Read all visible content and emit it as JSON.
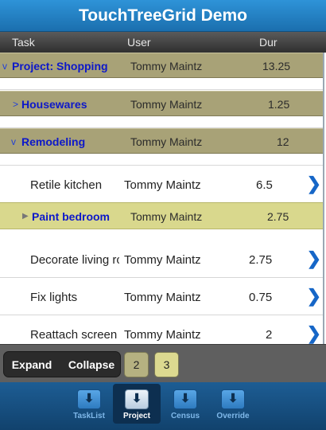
{
  "app": {
    "title": "TouchTreeGrid Demo"
  },
  "columns": {
    "task": "Task",
    "user": "User",
    "dur": "Dur"
  },
  "rows": {
    "project": {
      "twist": "v",
      "task": "Project: Shopping",
      "user": "Tommy Maintz",
      "dur": "13.25"
    },
    "housewares": {
      "twist": ">",
      "task": "Housewares",
      "user": "Tommy Maintz",
      "dur": "1.25"
    },
    "remodeling": {
      "twist": "v",
      "task": "Remodeling",
      "user": "Tommy Maintz",
      "dur": "12"
    },
    "retile": {
      "task": "Retile kitchen",
      "user": "Tommy Maintz",
      "dur": "6.5"
    },
    "paint": {
      "twist": "▶",
      "task": "Paint bedroom",
      "user": "Tommy Maintz",
      "dur": "2.75"
    },
    "decorate": {
      "task": "Decorate living room",
      "user": "Tommy Maintz",
      "dur": "2.75"
    },
    "fixlights": {
      "task": "Fix lights",
      "user": "Tommy Maintz",
      "dur": "0.75"
    },
    "reattach": {
      "task": "Reattach screen door",
      "user": "Tommy Maintz",
      "dur": "2"
    }
  },
  "chevron": "❯",
  "toolbar": {
    "expand": "Expand",
    "collapse": "Collapse",
    "page2": "2",
    "page3": "3"
  },
  "tabs": [
    {
      "label": "TaskList",
      "icon": "download-box-icon"
    },
    {
      "label": "Project",
      "icon": "download-box-icon",
      "active": true
    },
    {
      "label": "Census",
      "icon": "download-box-icon"
    },
    {
      "label": "Override",
      "icon": "download-box-icon"
    }
  ],
  "colors": {
    "accent": "#1b6fae",
    "group": "#a8a277",
    "subgroup": "#d9d88d",
    "link": "#0d18c9"
  }
}
